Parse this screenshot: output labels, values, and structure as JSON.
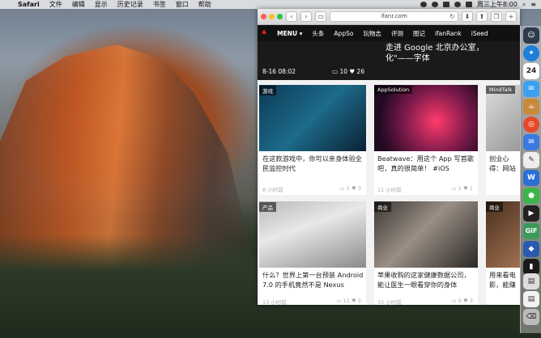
{
  "menubar": {
    "apple": "",
    "items": [
      "Safari",
      "文件",
      "编辑",
      "显示",
      "历史记录",
      "书签",
      "窗口",
      "帮助"
    ],
    "clock": "周三上午8:00"
  },
  "safari": {
    "url": "ifanr.com",
    "back": "‹",
    "forward": "›",
    "plus": "+"
  },
  "nav": {
    "logo": "♠",
    "menu_label": "MENU ▾",
    "items": [
      "头条",
      "AppSo",
      "玩物志",
      "评测",
      "图记",
      "ifanRank",
      "iSeed"
    ]
  },
  "featured": {
    "title": "走进 Google 北京办公室，\n化\"——字体",
    "date": "8-16 08:02",
    "comments": "10",
    "likes": "26",
    "side_label": "Safari"
  },
  "cards": [
    {
      "tag": "游戏",
      "title": "在这款游戏中，你可以亲身体验全民监控时代",
      "time": "8 小时前",
      "comments": "1",
      "likes": "3"
    },
    {
      "tag": "AppSolution",
      "title": "Beatwave：用这个 App 写首歌吧，真的很简单！ #iOS",
      "time": "11 小时前",
      "comments": "1",
      "likes": "1"
    },
    {
      "tag": "MindTalk",
      "title": "创业心得：网站产品化",
      "time": "",
      "comments": "",
      "likes": ""
    },
    {
      "tag": "产品",
      "title": "什么？世界上第一台预装 Android 7.0 的手机竟然不是 Nexus",
      "time": "13 小时前",
      "comments": "11",
      "likes": "5"
    },
    {
      "tag": "商业",
      "title": "苹果收购的这家健康数据公司，能让医生一眼看穿你的身体",
      "time": "15 小时前",
      "comments": "9",
      "likes": "3"
    },
    {
      "tag": "商业",
      "title": "用来看电影，能赚",
      "time": "",
      "comments": "",
      "likes": ""
    }
  ],
  "dock": {
    "calendar_day": "24",
    "gif_label": "GIF"
  }
}
